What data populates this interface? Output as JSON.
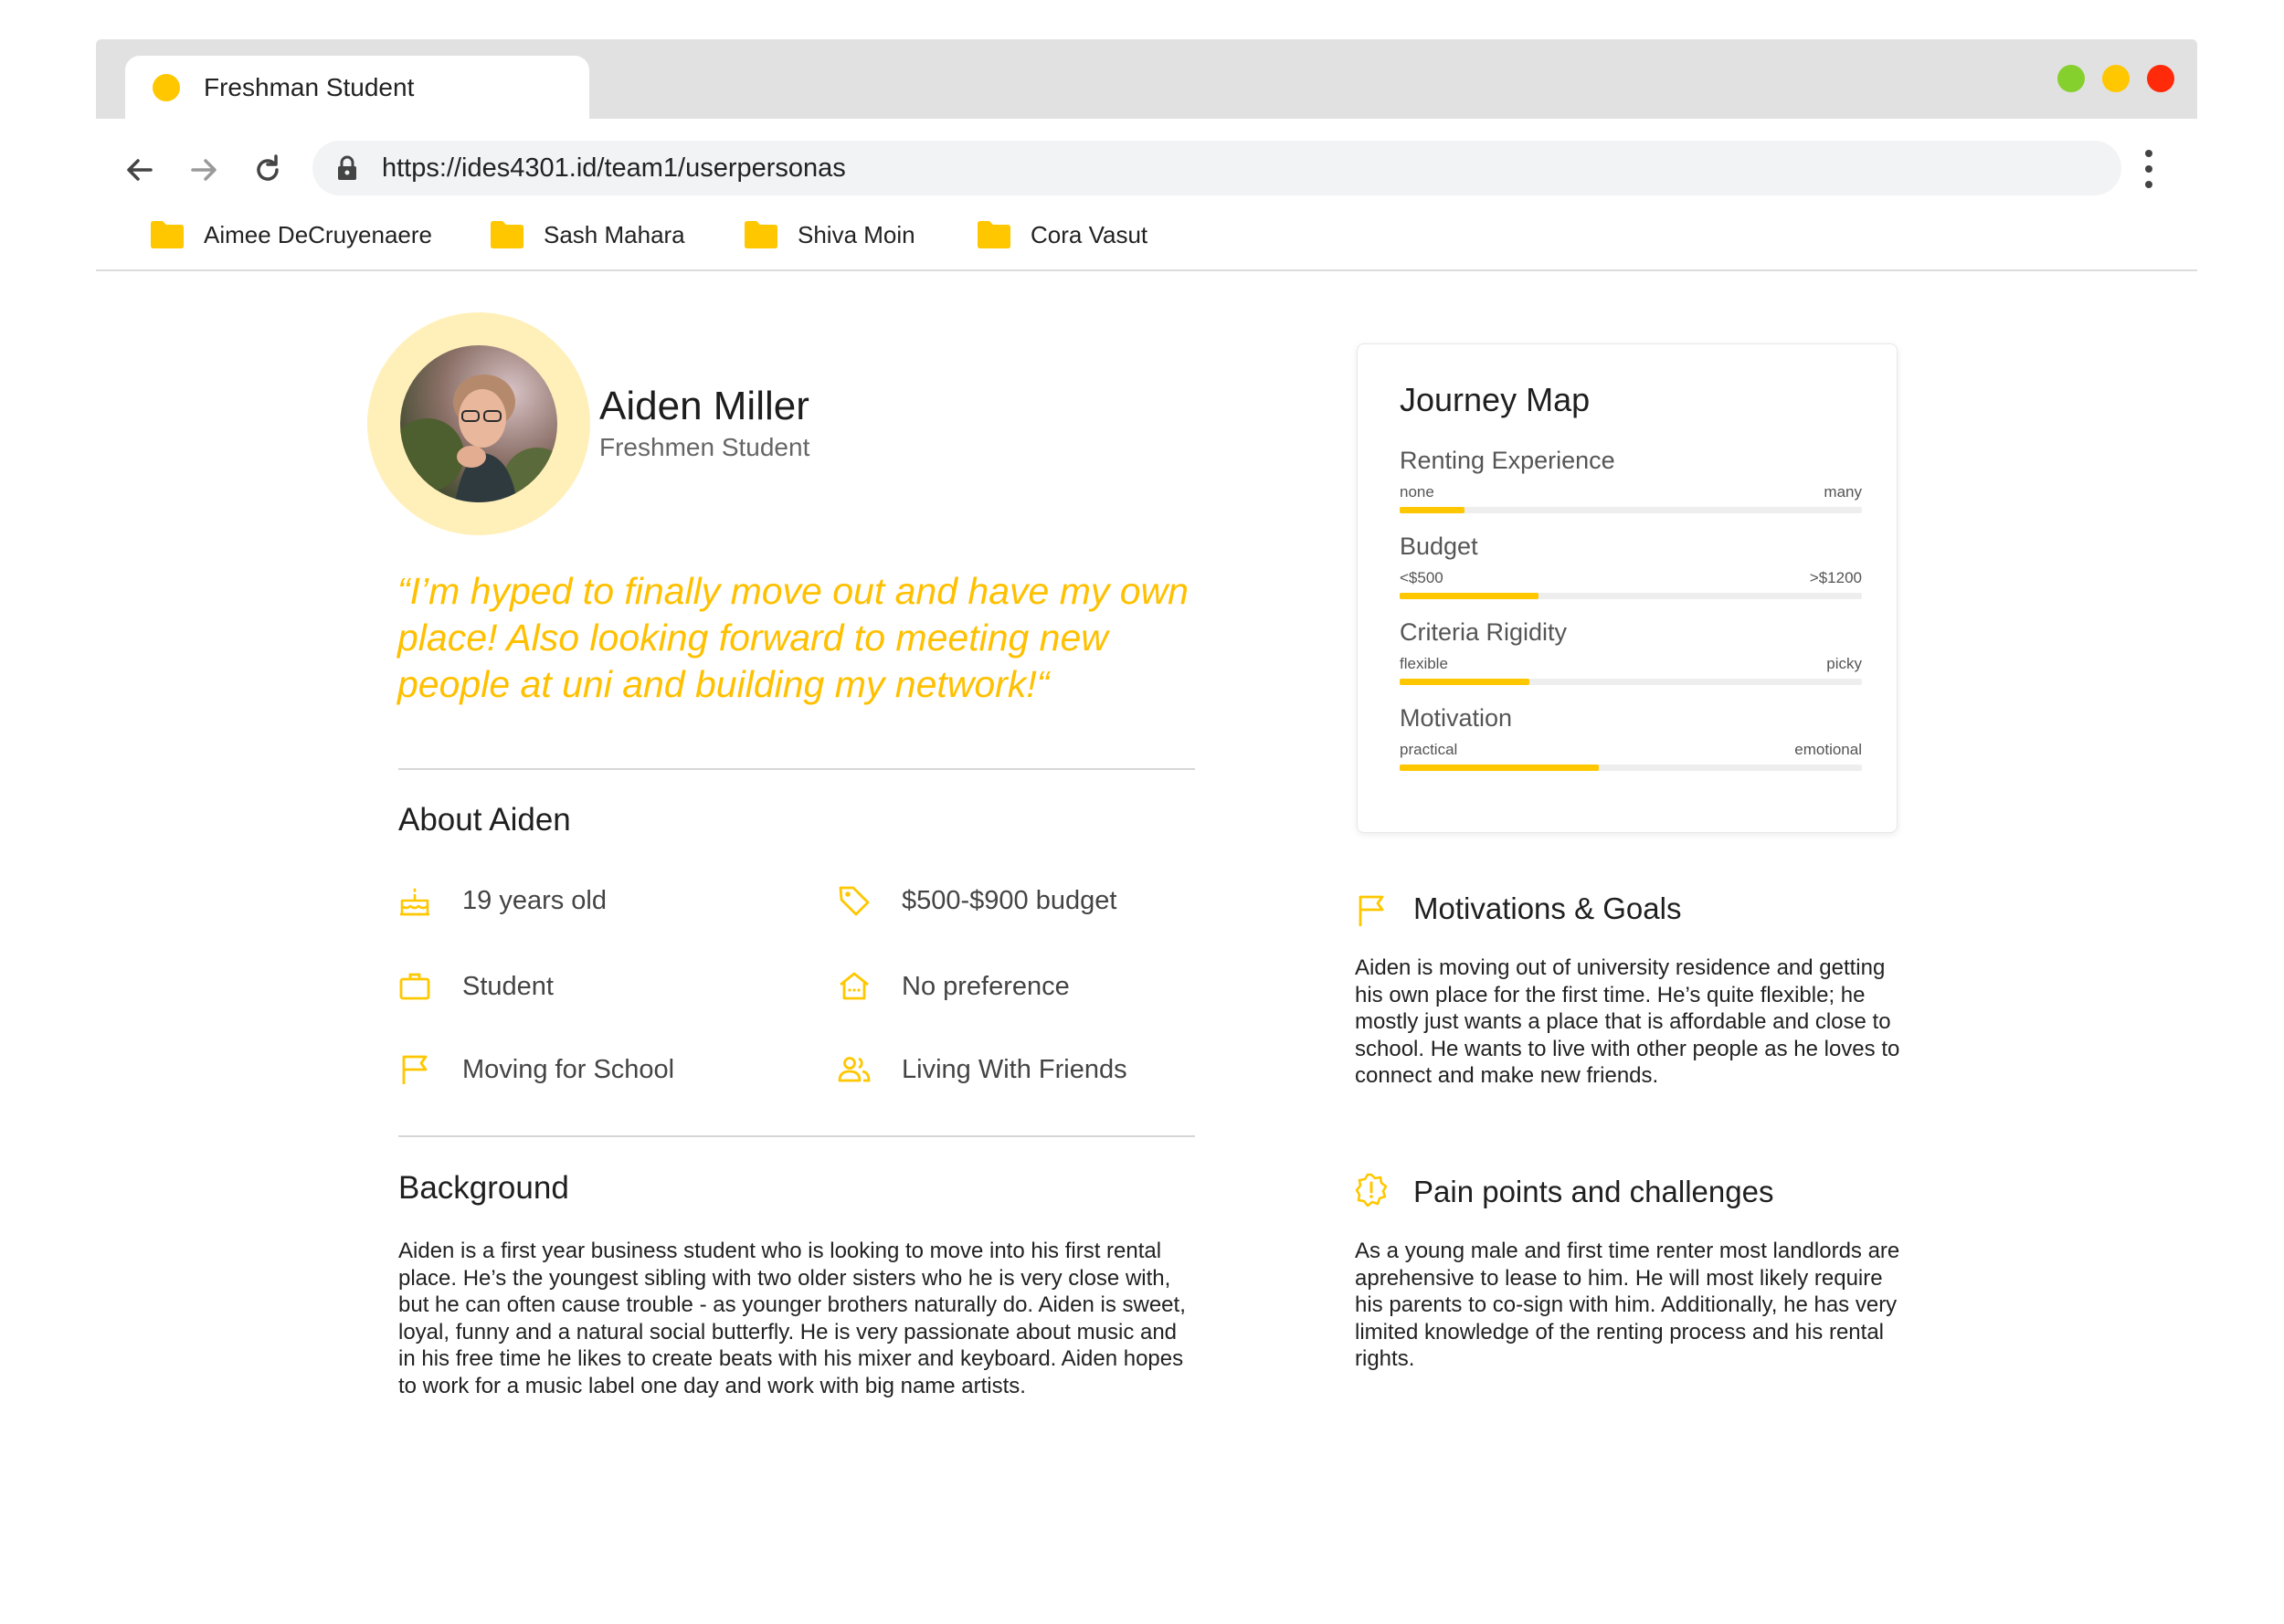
{
  "browser": {
    "tab_title": "Freshman Student",
    "url": "https://ides4301.id/team1/userpersonas",
    "bookmarks": [
      "Aimee DeCruyenaere",
      "Sash Mahara",
      "Shiva Moin",
      "Cora Vasut"
    ],
    "window_colors": {
      "green": "#86D02D",
      "yellow": "#FFC700",
      "red": "#FF2A0A"
    }
  },
  "persona": {
    "name": "Aiden Miller",
    "role": "Freshmen Student",
    "quote": "“I’m hyped to finally move out and have my own place! Also looking forward to meeting new people at uni and building my network!“"
  },
  "about": {
    "title": "About Aiden",
    "facts": [
      {
        "icon": "cake-icon",
        "text": "19 years old"
      },
      {
        "icon": "tag-icon",
        "text": "$500-$900 budget"
      },
      {
        "icon": "briefcase-icon",
        "text": "Student"
      },
      {
        "icon": "house-icon",
        "text": "No preference"
      },
      {
        "icon": "flag-icon",
        "text": "Moving for School"
      },
      {
        "icon": "people-icon",
        "text": "Living With Friends"
      }
    ]
  },
  "background": {
    "title": "Background",
    "text": "Aiden is a first year business student who is looking to move into his first rental place. He’s the youngest sibling with two older sisters who he is very close with, but he can often cause trouble - as younger brothers naturally do. Aiden is sweet, loyal, funny and a natural social butterfly. He is very passionate about music and in his free time he likes to create beats with his mixer and keyboard. Aiden hopes to work for a music label one day and work with big name artists."
  },
  "journey": {
    "title": "Journey Map",
    "metrics": [
      {
        "label": "Renting Experience",
        "low": "none",
        "high": "many",
        "value": 0.14
      },
      {
        "label": "Budget",
        "low": "<$500",
        "high": ">$1200",
        "value": 0.3
      },
      {
        "label": "Criteria Rigidity",
        "low": "flexible",
        "high": "picky",
        "value": 0.28
      },
      {
        "label": "Motivation",
        "low": "practical",
        "high": "emotional",
        "value": 0.43
      }
    ]
  },
  "goals": {
    "title": "Motivations & Goals",
    "text": "Aiden is moving out of university residence and getting his own place for the first time. He’s quite flexible; he mostly just wants a place that is affordable and close to school. He wants to live with other people as he loves to connect and make new friends."
  },
  "pain": {
    "title": "Pain points and challenges",
    "text": "As a young male and first time renter most landlords are aprehensive to lease to him. He will most likely require his parents to co-sign with him. Additionally, he has very limited knowledge of the renting process and his rental rights."
  },
  "accent_color": "#FFC700"
}
